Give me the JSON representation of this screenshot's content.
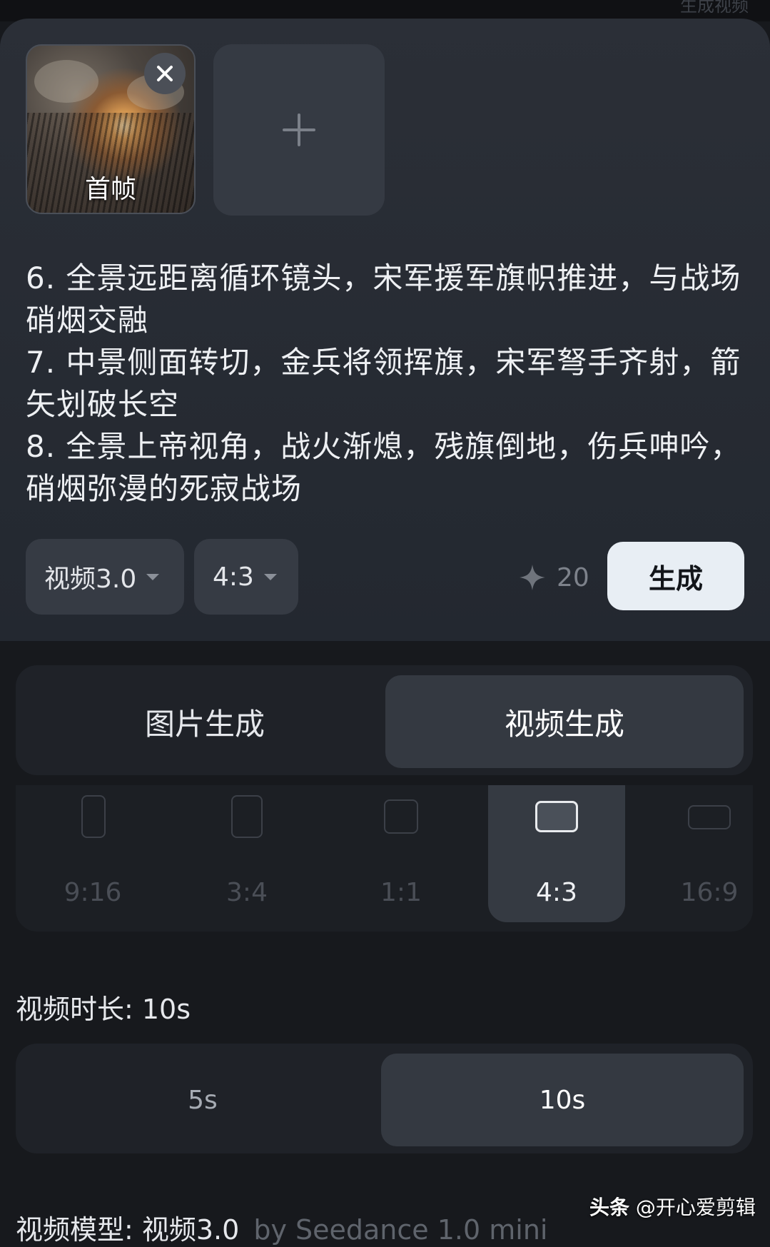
{
  "header": {
    "title": "生成视频"
  },
  "frames": {
    "first_frame_label": "首帧",
    "close_icon": "close-icon",
    "add_icon": "plus-icon"
  },
  "prompt": {
    "lines": [
      "6. 全景远距离循环镜头，宋军援军旗帜推进，与战场硝烟交融",
      "7. 中景侧面转切，金兵将领挥旗，宋军弩手齐射，箭矢划破长空",
      "8. 全景上帝视角，战火渐熄，残旗倒地，伤兵呻吟，硝烟弥漫的死寂战场"
    ]
  },
  "toolbar": {
    "model_label": "视频3.0",
    "ratio_label": "4:3",
    "cost": "20",
    "cost_icon": "sparkle-icon",
    "generate_label": "生成"
  },
  "mode_tabs": {
    "items": [
      "图片生成",
      "视频生成"
    ],
    "selected": "视频生成"
  },
  "ratios": {
    "items": [
      "9:16",
      "3:4",
      "1:1",
      "4:3",
      "16:9"
    ],
    "selected": "4:3"
  },
  "duration": {
    "label": "视频时长: 10s",
    "options": [
      "5s",
      "10s"
    ],
    "selected": "10s"
  },
  "model_info": {
    "label": "视频模型: 视频3.0",
    "by": "by Seedance 1.0 mini"
  },
  "watermark": {
    "brand": "头条",
    "handle": "@开心爱剪辑"
  },
  "colors": {
    "background": "#17191d",
    "panel": "#2b2f37",
    "active_segment": "#343941",
    "generate_button": "#e8eef4"
  }
}
